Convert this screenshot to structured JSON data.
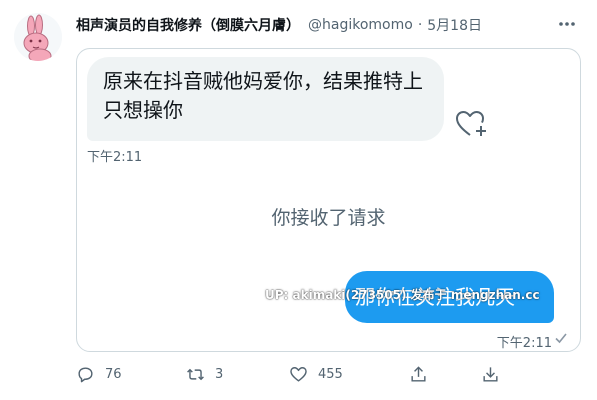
{
  "tweet": {
    "author_name": "相声演员的自我修养（倒膜六月膚）",
    "handle": "@hagikomomo",
    "separator": "·",
    "date": "5月18日",
    "avatar_icon": "pink-rabbit-avatar",
    "more_icon": "more-icon"
  },
  "conversation": {
    "incoming_message": "原来在抖音贼他妈爱你，结果推特上只想操你",
    "incoming_time": "下午2:11",
    "system_message": "你接收了请求",
    "outgoing_message": "那你在关注我几天",
    "outgoing_time": "下午2:11",
    "watermark": "UP: akimaki(273505) 发布于 mengzhan.cc"
  },
  "actions": {
    "reply_count": "76",
    "retweet_count": "3",
    "like_count": "455"
  },
  "colors": {
    "accent": "#1d9bf0",
    "bubble_gray": "#eff3f4",
    "muted": "#536471",
    "avatar_pink": "#f4a7b9"
  }
}
